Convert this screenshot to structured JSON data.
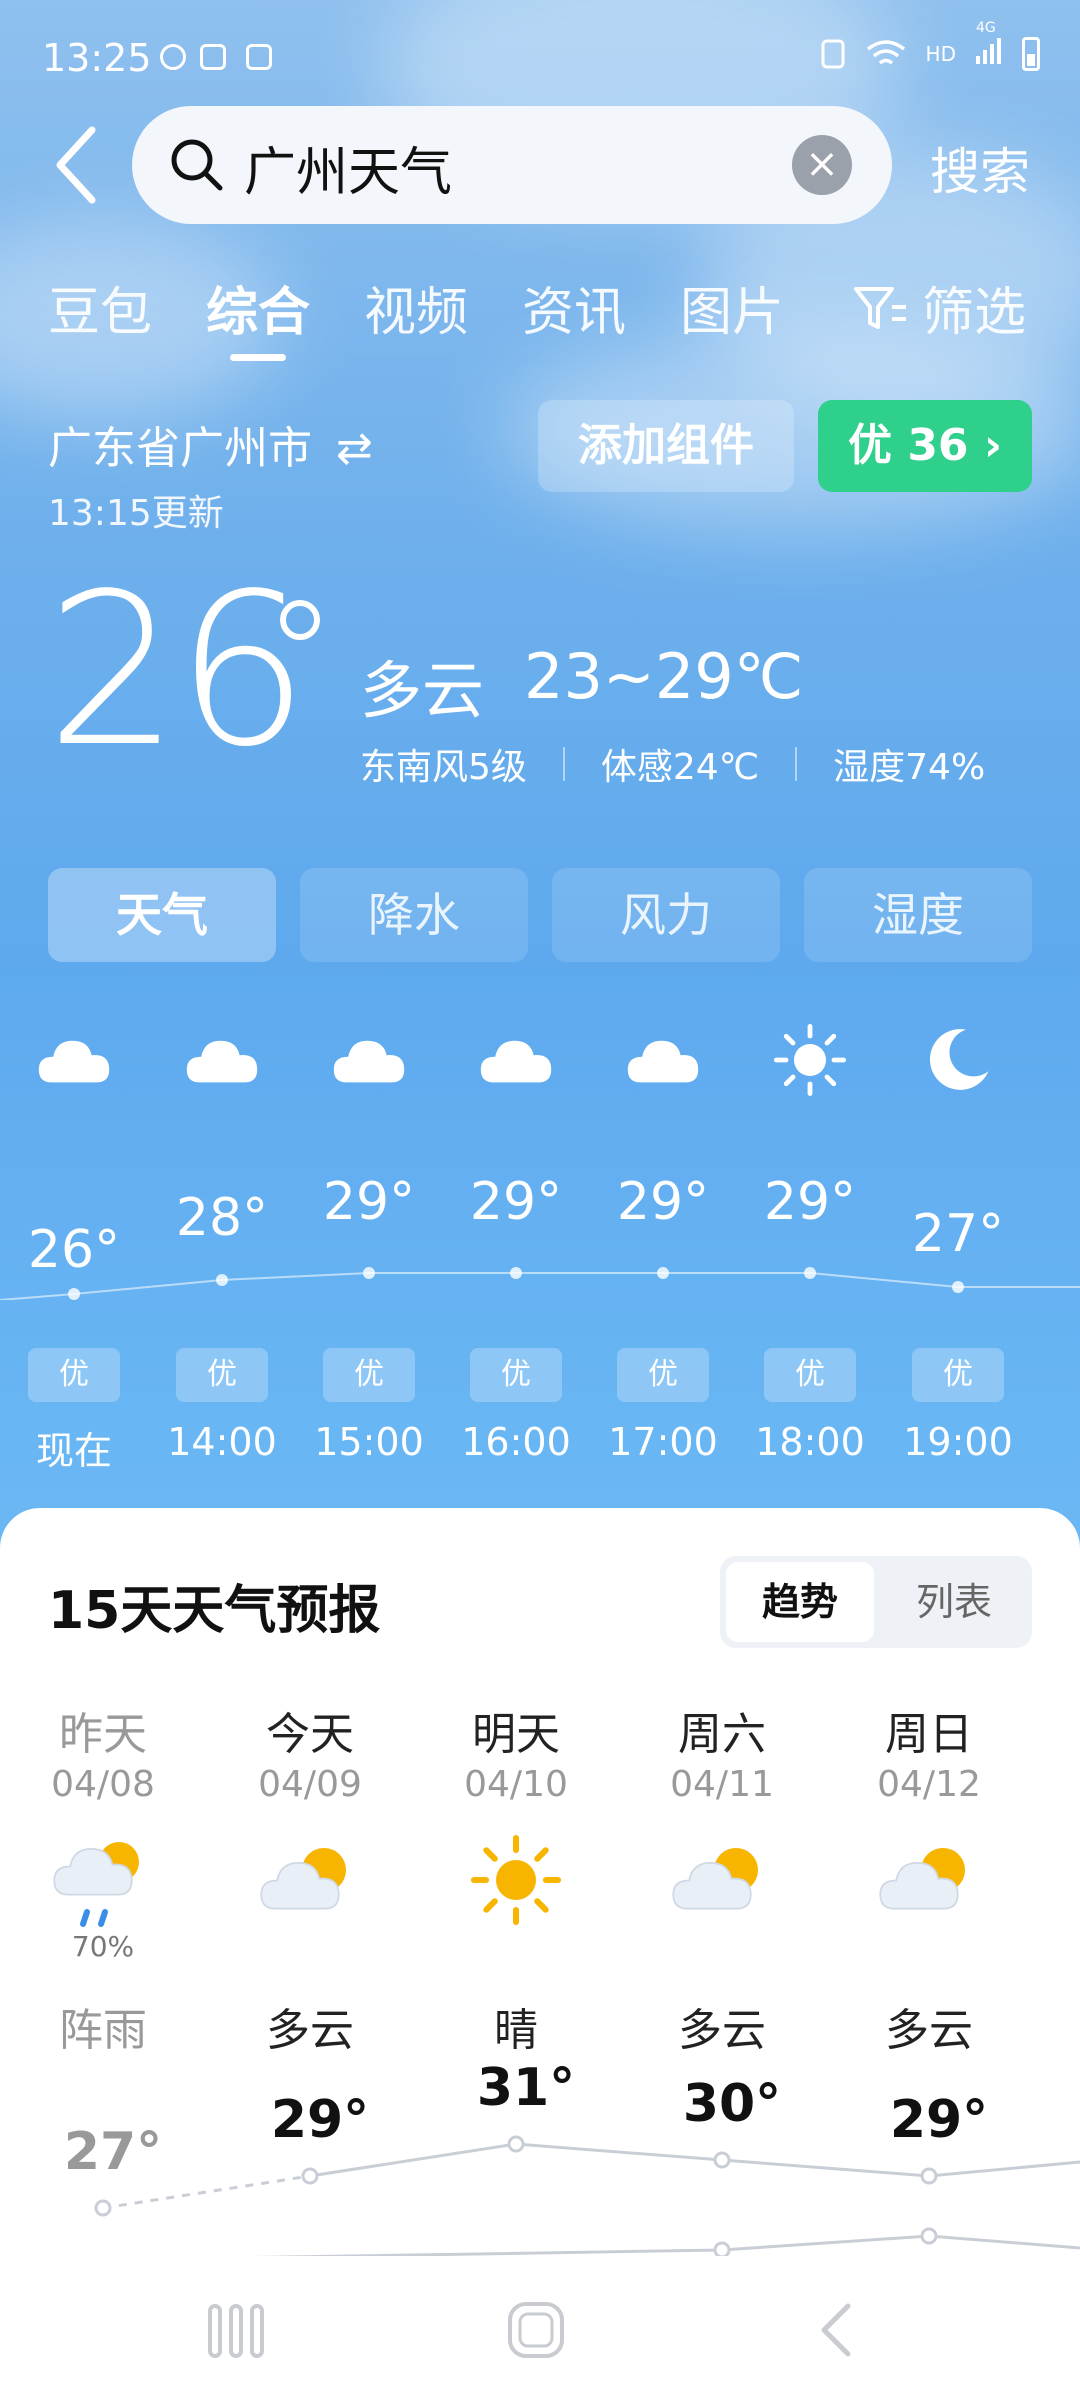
{
  "status_bar": {
    "time": "13:25",
    "network_label": "HD",
    "signal_label": "4G"
  },
  "search": {
    "query": "广州天气",
    "button_label": "搜索"
  },
  "tabs": [
    {
      "label": "豆包"
    },
    {
      "label": "综合"
    },
    {
      "label": "视频"
    },
    {
      "label": "资讯"
    },
    {
      "label": "图片"
    },
    {
      "label": "筛选"
    }
  ],
  "location": {
    "name": "广东省广州市",
    "updated": "13:15更新",
    "add_widget_label": "添加组件",
    "aqi_label": "优 36 ›",
    "aqi_color": "#2fcf8c"
  },
  "current": {
    "temp": "26",
    "condition": "多云",
    "range": "23~29℃",
    "wind": "东南风5级",
    "feels_like": "体感24℃",
    "humidity": "湿度74%"
  },
  "segments": [
    "天气",
    "降水",
    "风力",
    "湿度"
  ],
  "hourly": [
    {
      "icon": "cloud-icon",
      "temp": "26°",
      "aqi": "优",
      "time": "现在"
    },
    {
      "icon": "cloud-icon",
      "temp": "28°",
      "aqi": "优",
      "time": "14:00"
    },
    {
      "icon": "cloud-icon",
      "temp": "29°",
      "aqi": "优",
      "time": "15:00"
    },
    {
      "icon": "cloud-icon",
      "temp": "29°",
      "aqi": "优",
      "time": "16:00"
    },
    {
      "icon": "cloud-icon",
      "temp": "29°",
      "aqi": "优",
      "time": "17:00"
    },
    {
      "icon": "sun-icon",
      "temp": "29°",
      "aqi": "优",
      "time": "18:00"
    },
    {
      "icon": "moon-icon",
      "temp": "27°",
      "aqi": "优",
      "time": "19:00"
    }
  ],
  "forecast": {
    "title": "15天天气预报",
    "toggle_trend": "趋势",
    "toggle_list": "列表",
    "days": [
      {
        "name": "昨天",
        "date": "04/08",
        "icon": "rain-cloud-sun-icon",
        "precip": "70%",
        "condition": "阵雨",
        "high": "27°"
      },
      {
        "name": "今天",
        "date": "04/09",
        "icon": "partly-cloudy-icon",
        "precip": "",
        "condition": "多云",
        "high": "29°"
      },
      {
        "name": "明天",
        "date": "04/10",
        "icon": "sun-icon",
        "precip": "",
        "condition": "晴",
        "high": "31°"
      },
      {
        "name": "周六",
        "date": "04/11",
        "icon": "partly-cloudy-icon",
        "precip": "",
        "condition": "多云",
        "high": "30°"
      },
      {
        "name": "周日",
        "date": "04/12",
        "icon": "partly-cloudy-icon",
        "precip": "",
        "condition": "多云",
        "high": "29°"
      }
    ]
  },
  "colors": {
    "sky_top": "#8fc0ee",
    "sky_bottom": "#7cc0f6",
    "aqi_good": "#2fcf8c",
    "sun": "#f7b500"
  }
}
